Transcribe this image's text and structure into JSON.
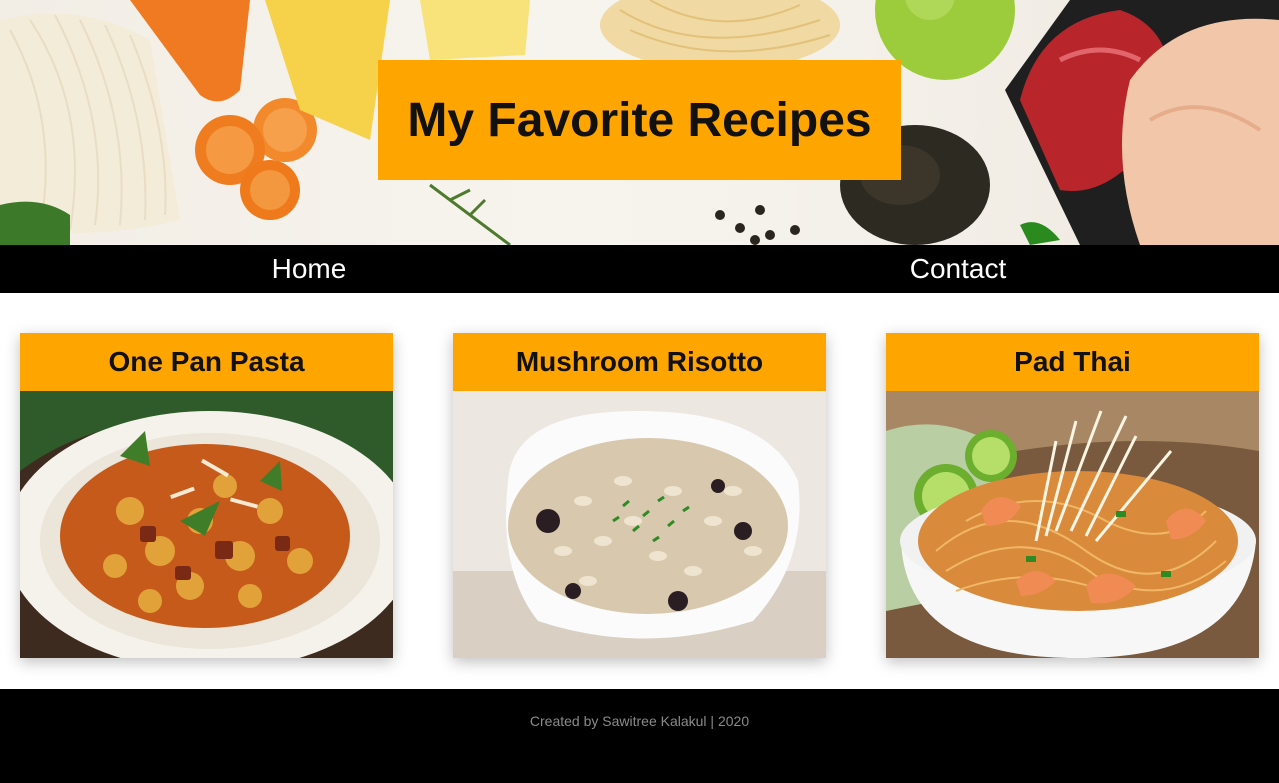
{
  "header": {
    "title": "My Favorite Recipes"
  },
  "nav": {
    "items": [
      {
        "label": "Home"
      },
      {
        "label": "Contact"
      }
    ]
  },
  "recipes": [
    {
      "title": "One Pan Pasta",
      "image": "pasta-photo"
    },
    {
      "title": "Mushroom Risotto",
      "image": "risotto-photo"
    },
    {
      "title": "Pad Thai",
      "image": "pad-thai-photo"
    }
  ],
  "footer": {
    "text": "Created by Sawitree Kalakul | 2020"
  },
  "colors": {
    "accent": "#ffa500",
    "nav_bg": "#000000",
    "footer_text": "#8a8a8a"
  }
}
